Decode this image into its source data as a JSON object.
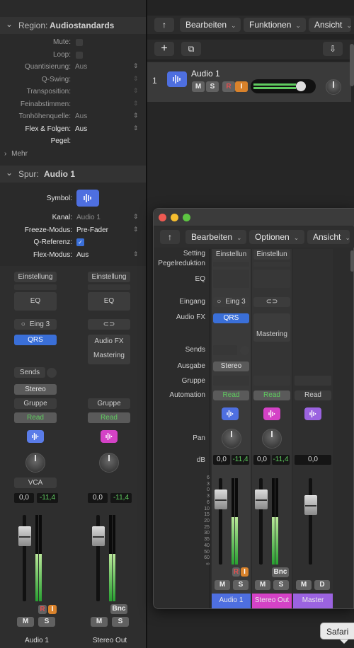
{
  "colors": {
    "accent": "#3a6fd8",
    "track_audio": "#4e6fe0",
    "track_stereo": "#d442c6",
    "track_master": "#9b63e0",
    "read_green": "#5fcc5f",
    "record_red": "#c94040",
    "input_orange": "#d9822b"
  },
  "inspector": {
    "region_header": {
      "label": "Region:",
      "name": "Audiostandards"
    },
    "region_params": [
      {
        "label": "Mute:",
        "value": "",
        "type": "checkbox"
      },
      {
        "label": "Loop:",
        "value": "",
        "type": "checkbox"
      },
      {
        "label": "Quantisierung:",
        "value": "Aus"
      },
      {
        "label": "Q-Swing:",
        "value": ""
      },
      {
        "label": "Transposition:",
        "value": ""
      },
      {
        "label": "Feinabstimmen:",
        "value": ""
      },
      {
        "label": "Tonhöhenquelle:",
        "value": "Aus"
      },
      {
        "label": "Flex & Folgen:",
        "value": "Aus"
      },
      {
        "label": "Pegel:",
        "value": ""
      }
    ],
    "more": "Mehr",
    "track_header": {
      "label": "Spur:",
      "name": "Audio 1"
    },
    "symbol_label": "Symbol:",
    "track_params": [
      {
        "label": "Kanal:",
        "value": "Audio 1"
      },
      {
        "label": "Freeze-Modus:",
        "value": "Pre-Fader"
      },
      {
        "label": "Q-Referenz:",
        "value": "✓"
      },
      {
        "label": "Flex-Modus:",
        "value": "Aus"
      }
    ],
    "strip1": {
      "setting": "Einstellung",
      "eq": "EQ",
      "input_icon": "○",
      "input": "Eing 3",
      "fx": "QRS",
      "sends": "Sends",
      "output": "Stereo",
      "group": "Gruppe",
      "automation": "Read",
      "vca": "VCA",
      "pan_val": "0,0",
      "peak": "-11,4",
      "r": "R",
      "i": "I",
      "m": "M",
      "s": "S",
      "name": "Audio 1",
      "level": 0.55
    },
    "strip2": {
      "setting": "Einstellung",
      "eq": "EQ",
      "link_icon": "⊂⊃",
      "fx1": "Audio FX",
      "fx2": "Mastering",
      "group": "Gruppe",
      "automation": "Read",
      "pan_val": "0,0",
      "peak": "-11,4",
      "bnc": "Bnc",
      "m": "M",
      "s": "S",
      "name": "Stereo Out",
      "level": 0.55
    }
  },
  "main": {
    "toolbar": {
      "back_icon": "↑",
      "menus": [
        "Bearbeiten",
        "Funktionen",
        "Ansicht"
      ],
      "add_icon": "+",
      "dup_icon": "⧉",
      "inbox_icon": "⇩"
    },
    "track": {
      "number": "1",
      "name": "Audio 1",
      "m": "M",
      "s": "S",
      "r": "R",
      "i": "I",
      "volume": 0.8
    }
  },
  "mixer": {
    "menus": [
      "Bearbeiten",
      "Optionen",
      "Ansicht"
    ],
    "row_labels": [
      "Setting",
      "Pegelreduktion",
      "EQ",
      "Eingang",
      "Audio FX",
      "Sends",
      "Ausgabe",
      "Gruppe",
      "Automation",
      "Pan",
      "dB"
    ],
    "strips": [
      {
        "setting": "Einstellun",
        "input_icon": "○",
        "input": "Eing 3",
        "fx": "QRS",
        "output": "Stereo",
        "automation": "Read",
        "pan_val": "0,0",
        "peak": "-11,4",
        "r": "R",
        "i": "I",
        "m": "M",
        "s": "S",
        "name": "Audio 1",
        "level": 0.55
      },
      {
        "setting": "Einstellun",
        "link_icon": "⊂⊃",
        "fx": "Mastering",
        "automation": "Read",
        "pan_val": "0,0",
        "peak": "-11,4",
        "bnc": "Bnc",
        "m": "M",
        "s": "S",
        "name": "Stereo Out",
        "level": 0.55
      },
      {
        "automation": "Read",
        "pan_val": "0,0",
        "m": "M",
        "d": "D",
        "name": "Master",
        "level": 0
      }
    ],
    "scale": [
      "6",
      "3",
      "0",
      "3",
      "6",
      "10",
      "15",
      "20",
      "25",
      "30",
      "35",
      "40",
      "50",
      "60",
      "∞"
    ]
  },
  "dock_tooltip": "Safari"
}
